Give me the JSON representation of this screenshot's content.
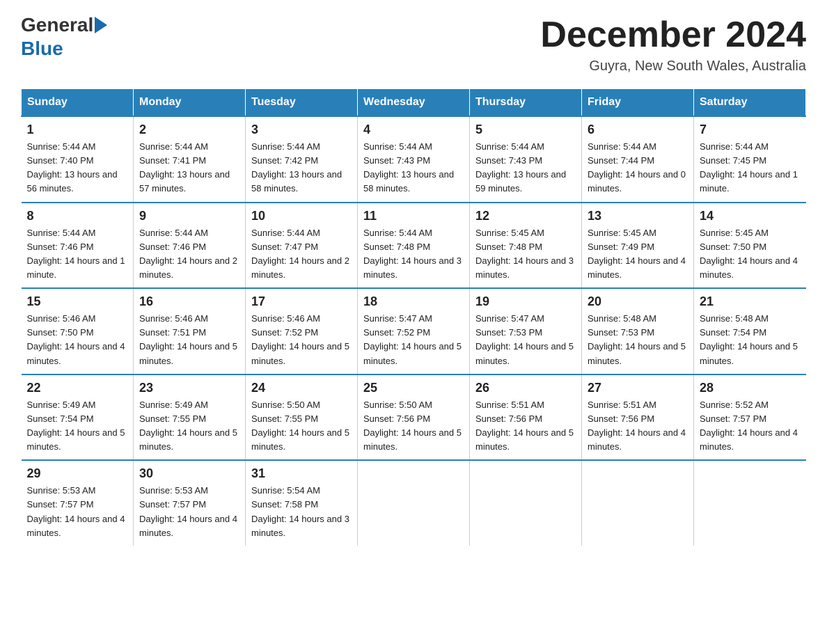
{
  "logo": {
    "general": "General",
    "blue": "Blue"
  },
  "title": "December 2024",
  "location": "Guyra, New South Wales, Australia",
  "days_of_week": [
    "Sunday",
    "Monday",
    "Tuesday",
    "Wednesday",
    "Thursday",
    "Friday",
    "Saturday"
  ],
  "weeks": [
    [
      {
        "day": "1",
        "sunrise": "5:44 AM",
        "sunset": "7:40 PM",
        "daylight": "13 hours and 56 minutes."
      },
      {
        "day": "2",
        "sunrise": "5:44 AM",
        "sunset": "7:41 PM",
        "daylight": "13 hours and 57 minutes."
      },
      {
        "day": "3",
        "sunrise": "5:44 AM",
        "sunset": "7:42 PM",
        "daylight": "13 hours and 58 minutes."
      },
      {
        "day": "4",
        "sunrise": "5:44 AM",
        "sunset": "7:43 PM",
        "daylight": "13 hours and 58 minutes."
      },
      {
        "day": "5",
        "sunrise": "5:44 AM",
        "sunset": "7:43 PM",
        "daylight": "13 hours and 59 minutes."
      },
      {
        "day": "6",
        "sunrise": "5:44 AM",
        "sunset": "7:44 PM",
        "daylight": "14 hours and 0 minutes."
      },
      {
        "day": "7",
        "sunrise": "5:44 AM",
        "sunset": "7:45 PM",
        "daylight": "14 hours and 1 minute."
      }
    ],
    [
      {
        "day": "8",
        "sunrise": "5:44 AM",
        "sunset": "7:46 PM",
        "daylight": "14 hours and 1 minute."
      },
      {
        "day": "9",
        "sunrise": "5:44 AM",
        "sunset": "7:46 PM",
        "daylight": "14 hours and 2 minutes."
      },
      {
        "day": "10",
        "sunrise": "5:44 AM",
        "sunset": "7:47 PM",
        "daylight": "14 hours and 2 minutes."
      },
      {
        "day": "11",
        "sunrise": "5:44 AM",
        "sunset": "7:48 PM",
        "daylight": "14 hours and 3 minutes."
      },
      {
        "day": "12",
        "sunrise": "5:45 AM",
        "sunset": "7:48 PM",
        "daylight": "14 hours and 3 minutes."
      },
      {
        "day": "13",
        "sunrise": "5:45 AM",
        "sunset": "7:49 PM",
        "daylight": "14 hours and 4 minutes."
      },
      {
        "day": "14",
        "sunrise": "5:45 AM",
        "sunset": "7:50 PM",
        "daylight": "14 hours and 4 minutes."
      }
    ],
    [
      {
        "day": "15",
        "sunrise": "5:46 AM",
        "sunset": "7:50 PM",
        "daylight": "14 hours and 4 minutes."
      },
      {
        "day": "16",
        "sunrise": "5:46 AM",
        "sunset": "7:51 PM",
        "daylight": "14 hours and 5 minutes."
      },
      {
        "day": "17",
        "sunrise": "5:46 AM",
        "sunset": "7:52 PM",
        "daylight": "14 hours and 5 minutes."
      },
      {
        "day": "18",
        "sunrise": "5:47 AM",
        "sunset": "7:52 PM",
        "daylight": "14 hours and 5 minutes."
      },
      {
        "day": "19",
        "sunrise": "5:47 AM",
        "sunset": "7:53 PM",
        "daylight": "14 hours and 5 minutes."
      },
      {
        "day": "20",
        "sunrise": "5:48 AM",
        "sunset": "7:53 PM",
        "daylight": "14 hours and 5 minutes."
      },
      {
        "day": "21",
        "sunrise": "5:48 AM",
        "sunset": "7:54 PM",
        "daylight": "14 hours and 5 minutes."
      }
    ],
    [
      {
        "day": "22",
        "sunrise": "5:49 AM",
        "sunset": "7:54 PM",
        "daylight": "14 hours and 5 minutes."
      },
      {
        "day": "23",
        "sunrise": "5:49 AM",
        "sunset": "7:55 PM",
        "daylight": "14 hours and 5 minutes."
      },
      {
        "day": "24",
        "sunrise": "5:50 AM",
        "sunset": "7:55 PM",
        "daylight": "14 hours and 5 minutes."
      },
      {
        "day": "25",
        "sunrise": "5:50 AM",
        "sunset": "7:56 PM",
        "daylight": "14 hours and 5 minutes."
      },
      {
        "day": "26",
        "sunrise": "5:51 AM",
        "sunset": "7:56 PM",
        "daylight": "14 hours and 5 minutes."
      },
      {
        "day": "27",
        "sunrise": "5:51 AM",
        "sunset": "7:56 PM",
        "daylight": "14 hours and 4 minutes."
      },
      {
        "day": "28",
        "sunrise": "5:52 AM",
        "sunset": "7:57 PM",
        "daylight": "14 hours and 4 minutes."
      }
    ],
    [
      {
        "day": "29",
        "sunrise": "5:53 AM",
        "sunset": "7:57 PM",
        "daylight": "14 hours and 4 minutes."
      },
      {
        "day": "30",
        "sunrise": "5:53 AM",
        "sunset": "7:57 PM",
        "daylight": "14 hours and 4 minutes."
      },
      {
        "day": "31",
        "sunrise": "5:54 AM",
        "sunset": "7:58 PM",
        "daylight": "14 hours and 3 minutes."
      },
      {
        "day": "",
        "sunrise": "",
        "sunset": "",
        "daylight": ""
      },
      {
        "day": "",
        "sunrise": "",
        "sunset": "",
        "daylight": ""
      },
      {
        "day": "",
        "sunrise": "",
        "sunset": "",
        "daylight": ""
      },
      {
        "day": "",
        "sunrise": "",
        "sunset": "",
        "daylight": ""
      }
    ]
  ],
  "labels": {
    "sunrise_prefix": "Sunrise: ",
    "sunset_prefix": "Sunset: ",
    "daylight_prefix": "Daylight: "
  }
}
